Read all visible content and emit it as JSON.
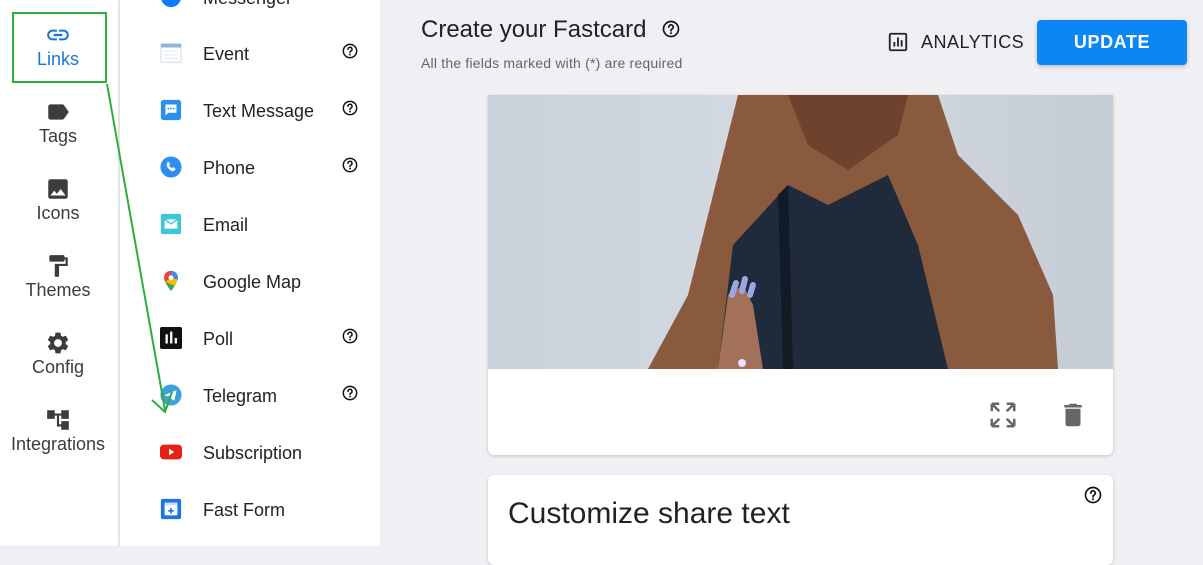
{
  "rail": {
    "items": [
      {
        "label": "Links",
        "icon": "link-icon",
        "active": true
      },
      {
        "label": "Tags",
        "icon": "tag-icon"
      },
      {
        "label": "Icons",
        "icon": "image-icon"
      },
      {
        "label": "Themes",
        "icon": "paint-roller-icon"
      },
      {
        "label": "Config",
        "icon": "gear-icon"
      },
      {
        "label": "Integrations",
        "icon": "hierarchy-icon"
      }
    ]
  },
  "links": {
    "items": [
      {
        "label": "Messenger",
        "icon": "messenger-icon",
        "help": false
      },
      {
        "label": "Event",
        "icon": "calendar-icon",
        "help": true
      },
      {
        "label": "Text Message",
        "icon": "message-icon",
        "help": true
      },
      {
        "label": "Phone",
        "icon": "phone-icon",
        "help": true
      },
      {
        "label": "Email",
        "icon": "email-icon",
        "help": false
      },
      {
        "label": "Google Map",
        "icon": "map-pin-icon",
        "help": false
      },
      {
        "label": "Poll",
        "icon": "poll-icon",
        "help": true
      },
      {
        "label": "Telegram",
        "icon": "telegram-icon",
        "help": true
      },
      {
        "label": "Subscription",
        "icon": "youtube-icon",
        "help": false
      },
      {
        "label": "Fast Form",
        "icon": "form-icon",
        "help": false
      }
    ]
  },
  "header": {
    "title": "Create your Fastcard",
    "subtitle": "All the fields marked with (*) are required",
    "analytics_label": "ANALYTICS",
    "update_label": "UPDATE"
  },
  "share": {
    "title": "Customize share text"
  },
  "colors": {
    "accent": "#0d86f5",
    "link_active": "#1976d2",
    "annotation": "#2eae3c"
  }
}
